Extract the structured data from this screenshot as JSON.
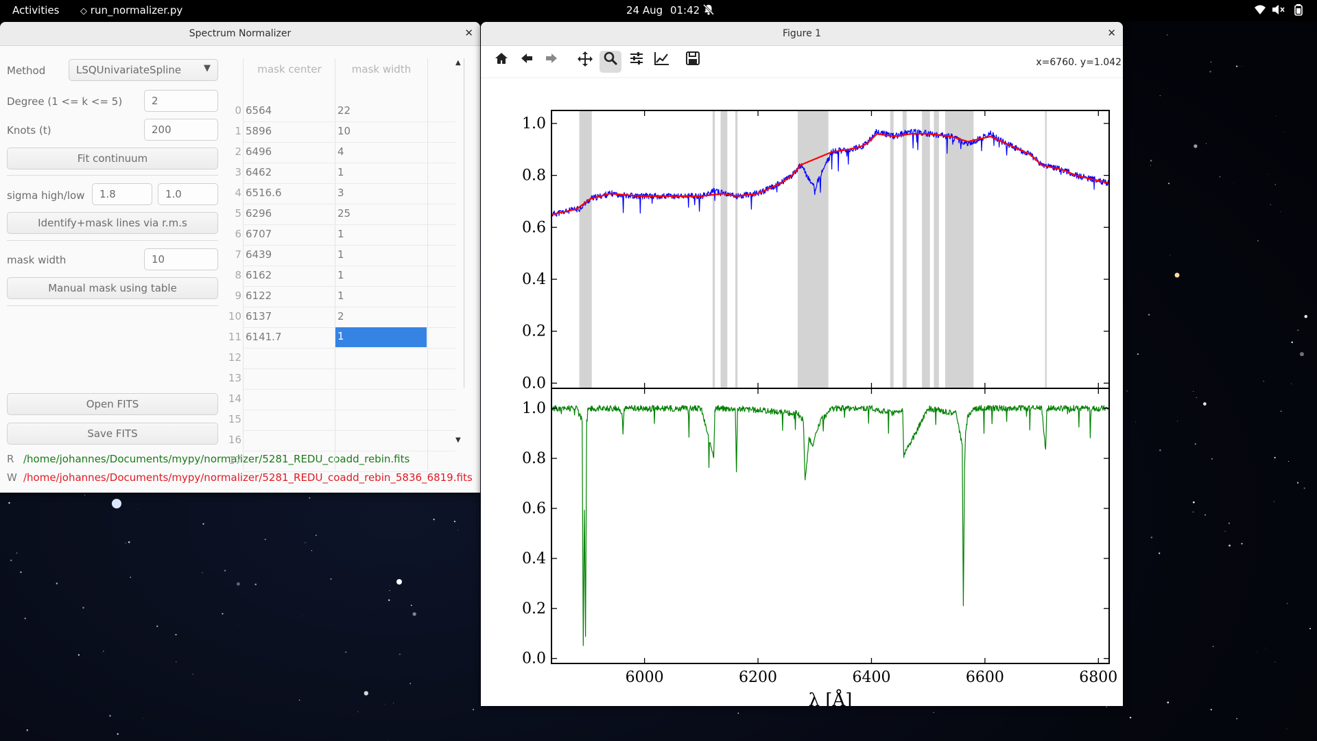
{
  "topbar": {
    "activities": "Activities",
    "app_name": "run_normalizer.py",
    "date": "24 Aug",
    "time": "01:42"
  },
  "normalizer": {
    "title": "Spectrum Normalizer",
    "method_label": "Method",
    "method_value": "LSQUnivariateSpline",
    "degree_label": "Degree (1 <= k <= 5)",
    "degree_value": "2",
    "knots_label": "Knots (t)",
    "knots_value": "200",
    "fit_button": "Fit continuum",
    "sigma_label": "sigma high/low",
    "sigma_high": "1.8",
    "sigma_low": "1.0",
    "identify_button": "Identify+mask lines via r.m.s",
    "mask_width_label": "mask width",
    "mask_width_value": "10",
    "manual_mask_button": "Manual mask using table",
    "open_button": "Open FITS",
    "save_button": "Save FITS",
    "read_prefix": "R",
    "read_path": "/home/johannes/Documents/mypy/normalizer/5281_REDU_coadd_rebin.fits",
    "write_prefix": "W",
    "write_path": "/home/johannes/Documents/mypy/normalizer/5281_REDU_coadd_rebin_5836_6819.fits",
    "table": {
      "headers": [
        "mask center",
        "mask width"
      ],
      "rows": [
        {
          "idx": "0",
          "center": "6564",
          "width": "22"
        },
        {
          "idx": "1",
          "center": "5896",
          "width": "10"
        },
        {
          "idx": "2",
          "center": "6496",
          "width": "4"
        },
        {
          "idx": "3",
          "center": "6462",
          "width": "1"
        },
        {
          "idx": "4",
          "center": "6516.6",
          "width": "3"
        },
        {
          "idx": "5",
          "center": "6296",
          "width": "25"
        },
        {
          "idx": "6",
          "center": "6707",
          "width": "1"
        },
        {
          "idx": "7",
          "center": "6439",
          "width": "1"
        },
        {
          "idx": "8",
          "center": "6162",
          "width": "1"
        },
        {
          "idx": "9",
          "center": "6122",
          "width": "1"
        },
        {
          "idx": "10",
          "center": "6137",
          "width": "2"
        },
        {
          "idx": "11",
          "center": "6141.7",
          "width": "1"
        },
        {
          "idx": "12",
          "center": "",
          "width": ""
        },
        {
          "idx": "13",
          "center": "",
          "width": ""
        },
        {
          "idx": "14",
          "center": "",
          "width": ""
        },
        {
          "idx": "15",
          "center": "",
          "width": ""
        },
        {
          "idx": "16",
          "center": "",
          "width": ""
        },
        {
          "idx": "17",
          "center": "",
          "width": ""
        }
      ]
    }
  },
  "figure": {
    "title": "Figure 1",
    "coords": "x=6760. y=1.042",
    "tools": [
      "home-icon",
      "back-icon",
      "forward-icon",
      "pan-icon",
      "zoom-icon",
      "configure-icon",
      "edit-axes-icon",
      "save-icon"
    ]
  },
  "colors": {
    "spectrum": "#0000ff",
    "continuum": "#ff0000",
    "normalized": "#008000",
    "mask": "#d3d3d3",
    "selection": "#3584e4"
  },
  "chart_data": [
    {
      "type": "line",
      "panel": "top",
      "xlim": [
        5836,
        6819
      ],
      "ylim": [
        -0.02,
        1.05
      ],
      "yticks": [
        "0.0",
        "0.2",
        "0.4",
        "0.6",
        "0.8",
        "1.0"
      ],
      "series": [
        {
          "role": "spectrum",
          "x": [
            5836,
            5860,
            5880,
            5884,
            5905,
            5940,
            5990,
            6050,
            6100,
            6123,
            6140,
            6160,
            6200,
            6240,
            6260,
            6275,
            6300,
            6330,
            6360,
            6380,
            6390,
            6410,
            6440,
            6470,
            6500,
            6540,
            6570,
            6590,
            6610,
            6630,
            6660,
            6680,
            6700,
            6720,
            6740,
            6760,
            6780,
            6800,
            6819
          ],
          "y": [
            0.65,
            0.66,
            0.67,
            0.67,
            0.71,
            0.73,
            0.72,
            0.72,
            0.72,
            0.74,
            0.73,
            0.72,
            0.73,
            0.77,
            0.8,
            0.84,
            0.75,
            0.89,
            0.9,
            0.91,
            0.92,
            0.97,
            0.95,
            0.97,
            0.96,
            0.95,
            0.92,
            0.94,
            0.96,
            0.93,
            0.9,
            0.88,
            0.84,
            0.83,
            0.82,
            0.8,
            0.79,
            0.78,
            0.77
          ]
        },
        {
          "role": "continuum",
          "x": [
            5836,
            5860,
            5880,
            5905,
            5940,
            5990,
            6050,
            6100,
            6140,
            6160,
            6200,
            6240,
            6260,
            6275,
            6330,
            6360,
            6380,
            6390,
            6410,
            6440,
            6470,
            6500,
            6540,
            6570,
            6590,
            6610,
            6630,
            6660,
            6680,
            6700,
            6720,
            6740,
            6760,
            6780,
            6800,
            6819
          ],
          "y": [
            0.65,
            0.66,
            0.67,
            0.71,
            0.73,
            0.72,
            0.72,
            0.72,
            0.73,
            0.72,
            0.73,
            0.77,
            0.8,
            0.84,
            0.89,
            0.9,
            0.91,
            0.92,
            0.96,
            0.95,
            0.96,
            0.96,
            0.95,
            0.93,
            0.94,
            0.95,
            0.93,
            0.9,
            0.88,
            0.84,
            0.83,
            0.82,
            0.8,
            0.79,
            0.78,
            0.77
          ]
        }
      ],
      "masks": [
        [
          5885,
          5907
        ],
        [
          6120,
          6124
        ],
        [
          6134,
          6146
        ],
        [
          6160,
          6164
        ],
        [
          6270,
          6324
        ],
        [
          6433,
          6439
        ],
        [
          6455,
          6462
        ],
        [
          6489,
          6503
        ],
        [
          6510,
          6519
        ],
        [
          6530,
          6580
        ],
        [
          6706,
          6709
        ]
      ]
    },
    {
      "type": "line",
      "panel": "bottom",
      "xlabel": "λ [Å]",
      "xlim": [
        5836,
        6819
      ],
      "ylim": [
        -0.02,
        1.08
      ],
      "xticks": [
        "6000",
        "6200",
        "6400",
        "6600",
        "6800"
      ],
      "yticks": [
        "0.0",
        "0.2",
        "0.4",
        "0.6",
        "0.8",
        "1.0"
      ],
      "series": [
        {
          "role": "normalized",
          "x": [
            5836,
            5880,
            5890,
            5892,
            5894,
            5896,
            5898,
            5900,
            5950,
            5960,
            5962,
            5964,
            6100,
            6122,
            6124,
            6160,
            6162,
            6164,
            6270,
            6280,
            6283,
            6290,
            6296,
            6310,
            6330,
            6400,
            6440,
            6455,
            6457,
            6500,
            6550,
            6560,
            6562,
            6564,
            6566,
            6570,
            6580,
            6600,
            6700,
            6707,
            6709,
            6819
          ],
          "y": [
            1.0,
            1.0,
            0.95,
            0.04,
            0.6,
            0.09,
            0.95,
            1.0,
            1.0,
            0.99,
            0.9,
            1.0,
            1.0,
            0.8,
            1.0,
            1.0,
            0.74,
            1.0,
            0.98,
            0.95,
            0.71,
            0.88,
            0.85,
            0.95,
            1.0,
            1.0,
            0.98,
            1.0,
            0.81,
            1.0,
            0.98,
            0.85,
            0.22,
            0.75,
            0.9,
            0.97,
            1.0,
            1.0,
            1.0,
            0.83,
            1.0,
            1.0
          ]
        }
      ]
    }
  ]
}
